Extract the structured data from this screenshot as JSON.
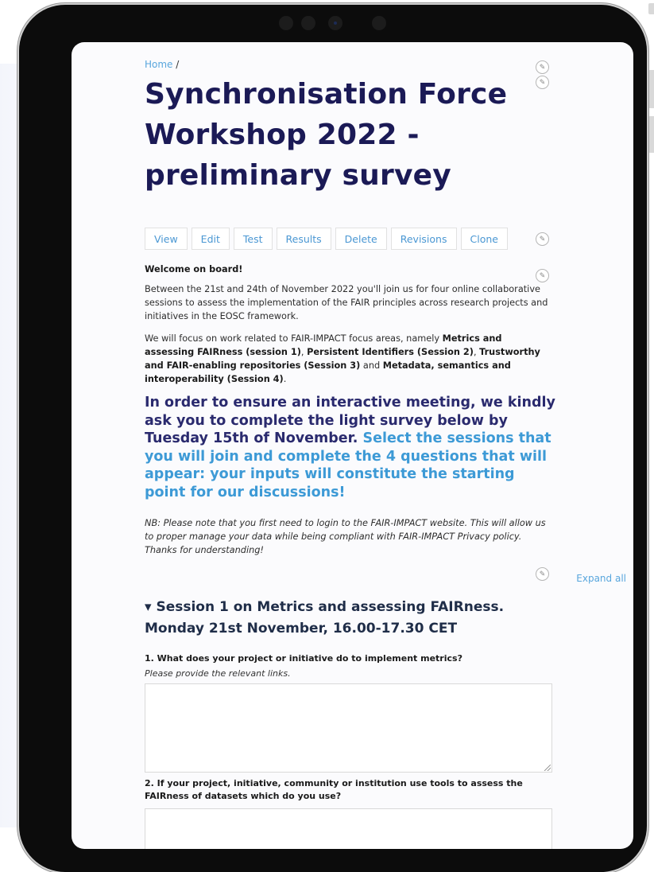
{
  "breadcrumb": {
    "home": "Home",
    "separator": "/"
  },
  "page": {
    "title": "Synchronisation Force Workshop 2022 - preliminary survey"
  },
  "tabs": [
    "View",
    "Edit",
    "Test",
    "Results",
    "Delete",
    "Revisions",
    "Clone"
  ],
  "intro": {
    "welcome": "Welcome on board!",
    "paragraph1": "Between the 21st and 24th of November 2022 you'll join us for four online collaborative sessions to assess the implementation of the FAIR principles across research projects and initiatives in the EOSC framework.",
    "p2_prefix": "We will focus on work related to FAIR-IMPACT focus areas, namely ",
    "p2_area1": "Metrics and assessing FAIRness (session 1)",
    "p2_sep1": ", ",
    "p2_area2": "Persistent Identifiers (Session 2)",
    "p2_sep2": ", ",
    "p2_area3": "Trustworthy and FAIR-enabling repositories (Session 3)",
    "p2_and": " and ",
    "p2_area4": "Metadata, semantics and interoperability (Session 4)",
    "p2_end": "."
  },
  "highlight": {
    "dark": "In order to ensure an interactive meeting, we kindly ask you to complete the light survey below by Tuesday 15th of November.",
    "light": "Select the sessions that you will join and complete the 4 questions that will appear: your inputs will constitute the starting point for our discussions!"
  },
  "nb": "NB: Please note that you first need to login to the FAIR-IMPACT website. This will allow us to proper manage your data while being compliant with FAIR-IMPACT Privacy policy. Thanks for understanding!",
  "expand_all": "Expand all",
  "session1": {
    "heading": "▾ Session 1 on Metrics and assessing FAIRness. Monday 21st November, 16.00-17.30 CET",
    "q1": "1. What does your project or initiative do to implement metrics?",
    "q1_help": "Please provide the relevant links.",
    "q1_value": "",
    "q2": "2. If your project, initiative, community or institution use tools to assess the FAIRness of datasets which do you use?",
    "q2_value": ""
  },
  "colors": {
    "title": "#1b1a56",
    "link": "#58a6dd",
    "accent_light": "#3d9ad6",
    "accent_dark": "#2a2a6e"
  },
  "icons": {
    "edit": "pencil-icon"
  }
}
